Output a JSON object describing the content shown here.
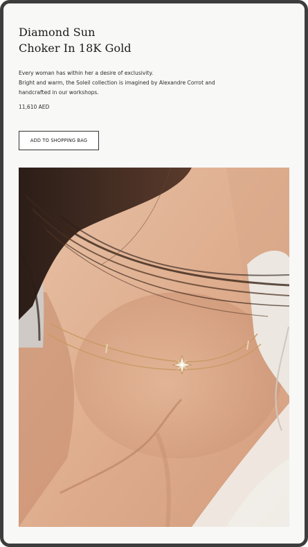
{
  "product": {
    "title_line1": "Diamond Sun",
    "title_line2": "Choker In 18K Gold",
    "description_line1": "Every woman has within her a desire of exclusivity.",
    "description_line2": "Bright and warm, the Soleil collection is imagined by Alexandre Corrot and",
    "description_line3": "handcrafted in our workshops.",
    "price": "11,610 AED"
  },
  "actions": {
    "add_to_bag_label": "ADD TO SHOPPING BAG"
  },
  "image": {
    "subject": "model-wearing-choker"
  },
  "colors": {
    "background": "#f8f8f7",
    "frame_border": "#3d3d3d",
    "text": "#1a1a1a",
    "skin": "#e1b394",
    "gold": "#c99a62"
  }
}
